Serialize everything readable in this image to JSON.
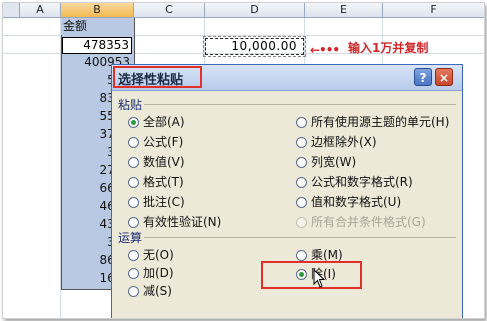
{
  "sheet": {
    "columns": [
      "A",
      "B",
      "C",
      "D",
      "E",
      "F"
    ],
    "active_column": "B",
    "header_cell": "金额",
    "column_b_values": [
      "478353",
      "400953",
      "556",
      "8371",
      "5570",
      "3720",
      "357",
      "2711",
      "6662",
      "4670",
      "4391",
      "371",
      "8611",
      "1603"
    ],
    "copy_cell_value": "10,000.00",
    "arrow": "←•••",
    "annotation": "输入1万并复制"
  },
  "dialog": {
    "title": "选择性粘贴",
    "help_label": "?",
    "close_label": "×",
    "paste_section": "粘贴",
    "paste_options_left": [
      "全部(A)",
      "公式(F)",
      "数值(V)",
      "格式(T)",
      "批注(C)",
      "有效性验证(N)"
    ],
    "paste_options_right": [
      "所有使用源主题的单元(H)",
      "边框除外(X)",
      "列宽(W)",
      "公式和数字格式(R)",
      "值和数字格式(U)",
      "所有合并条件格式(G)"
    ],
    "selected_paste": "全部(A)",
    "operation_section": "运算",
    "operation_options_left": [
      "无(O)",
      "加(D)",
      "减(S)"
    ],
    "operation_options_right": [
      "乘(M)",
      "除(I)"
    ],
    "selected_operation": "除(I)"
  },
  "colors": {
    "selection_blue": "#b9c9e3",
    "annotation_red": "#d0282a",
    "selected_radio": "#2c9b3e",
    "dialog_bg": "#ece9d8"
  }
}
